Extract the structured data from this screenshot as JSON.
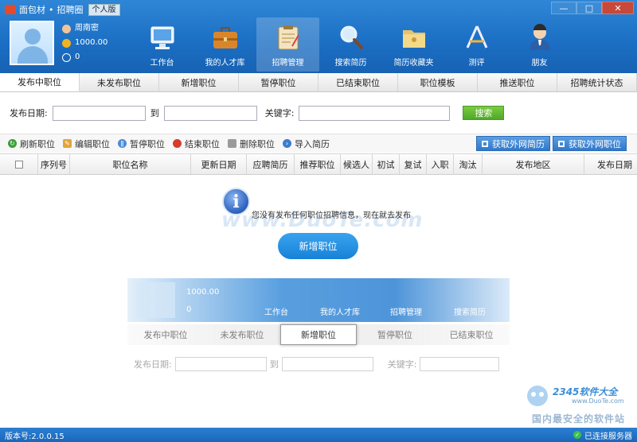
{
  "app": {
    "logo_text": "面包材",
    "separator": "•",
    "module": "招聘圈",
    "edition": "个人版"
  },
  "window": {
    "minimize": "—",
    "maximize": "□",
    "close": "✕"
  },
  "user": {
    "name": "周南密",
    "coins": "1000.00",
    "points": "0"
  },
  "nav": [
    {
      "label": "工作台",
      "icon": "monitor-icon"
    },
    {
      "label": "我的人才库",
      "icon": "briefcase-icon"
    },
    {
      "label": "招聘管理",
      "icon": "clipboard-icon",
      "active": true
    },
    {
      "label": "搜索简历",
      "icon": "magnifier-icon"
    },
    {
      "label": "简历收藏夹",
      "icon": "folder-icon"
    },
    {
      "label": "测评",
      "icon": "ruler-icon"
    },
    {
      "label": "朋友",
      "icon": "person-icon"
    }
  ],
  "tabs": [
    "发布中职位",
    "未发布职位",
    "新增职位",
    "暂停职位",
    "已结束职位",
    "职位模板",
    "推送职位",
    "招聘统计状态"
  ],
  "search": {
    "date_label": "发布日期:",
    "to_label": "到",
    "keyword_label": "关键字:",
    "button": "搜索"
  },
  "toolbar": {
    "refresh": "刷新职位",
    "edit": "编辑职位",
    "pause": "暂停职位",
    "end": "结束职位",
    "delete": "删除职位",
    "import": "导入简历",
    "ext_resume": "获取外网简历",
    "ext_job": "获取外网职位"
  },
  "columns": [
    "序列号",
    "职位名称",
    "更新日期",
    "应聘简历",
    "推荐职位",
    "候选人",
    "初试",
    "复试",
    "入职",
    "淘汰",
    "发布地区",
    "发布日期"
  ],
  "empty": {
    "icon": "i",
    "message": "您没有发布任何职位招聘信息，现在就去发布",
    "button": "新增职位"
  },
  "watermark": {
    "main": "www.DuoTe.com",
    "site_name": "2345软件大全",
    "site_url": "www.DuoTe.com",
    "slogan": "国内最安全的软件站"
  },
  "preview": {
    "coins": "1000.00",
    "points": "0",
    "nav": [
      "工作台",
      "我的人才库",
      "招聘管理",
      "搜索简历"
    ],
    "tabs": [
      "发布中职位",
      "未发布职位",
      "新增职位",
      "暂停职位",
      "已结束职位"
    ],
    "date_label": "发布日期:",
    "to_label": "到",
    "keyword_label": "关键字:"
  },
  "status": {
    "version": "版本号:2.0.0.15",
    "connection": "已连接服务器"
  },
  "colors": {
    "header": "#1b6ec3",
    "search_button": "#4fa82a",
    "accent": "#1781d7",
    "close": "#c8483a"
  }
}
